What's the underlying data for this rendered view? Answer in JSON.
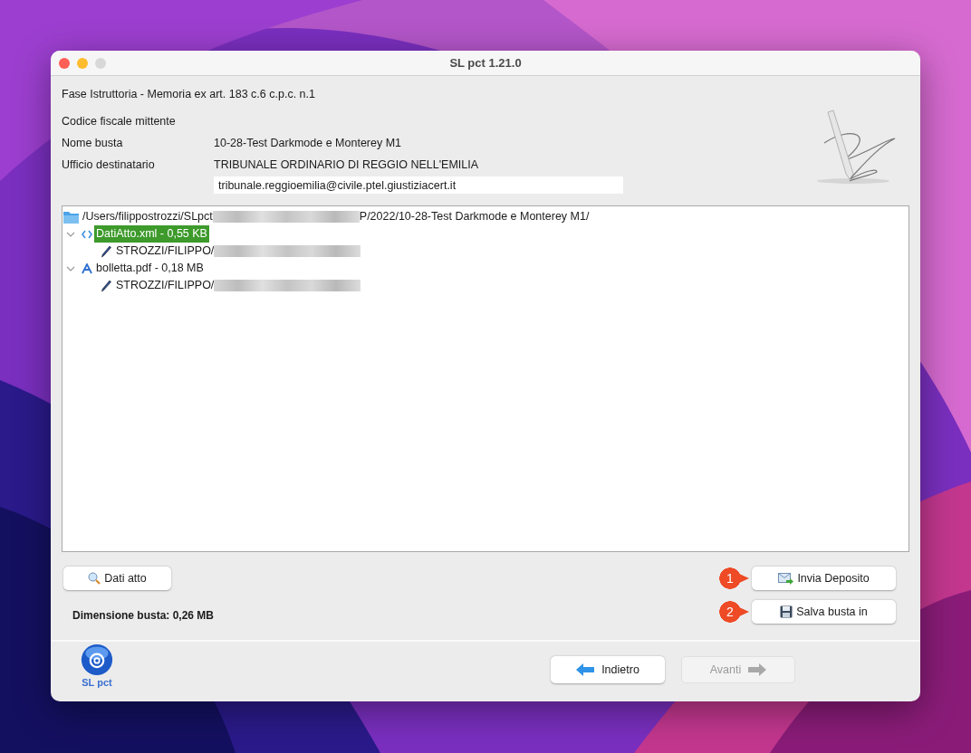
{
  "window": {
    "title": "SL pct 1.21.0"
  },
  "phase": "Fase Istruttoria - Memoria ex art. 183 c.6 c.p.c. n.1",
  "fields": [
    {
      "label": "Codice fiscale mittente"
    },
    {
      "label": "Nome busta",
      "value": "10-28-Test Darkmode e Monterey M1"
    },
    {
      "label": "Ufficio destinatario",
      "value": "TRIBUNALE ORDINARIO DI REGGIO NELL'EMILIA"
    }
  ],
  "email": {
    "value": "tribunale.reggioemilia@civile.ptel.giustiziacert.it"
  },
  "tree": {
    "path_start": "/Users/filippostrozzi/SLpct",
    "path_end": "P/2022/10-28-Test Darkmode e Monterey M1/",
    "children": [
      {
        "kind": "xml",
        "name": "DatiAtto.xml - 0,55 KB",
        "selected": true,
        "expanded": true,
        "children": [
          {
            "kind": "signature",
            "text": "STROZZI/FILIPPO/"
          }
        ]
      },
      {
        "kind": "pdf",
        "name": "bolletta.pdf - 0,18 MB",
        "selected": false,
        "expanded": true,
        "children": [
          {
            "kind": "signature",
            "text": "STROZZI/FILIPPO/"
          }
        ]
      }
    ]
  },
  "dati_button": "Dati atto",
  "size": "Dimensione busta: 0,26 MB",
  "actions": [
    {
      "kind": "send",
      "callout": "1",
      "label": "Invia Deposito"
    },
    {
      "kind": "save",
      "callout": "2",
      "label": "Salva busta in"
    }
  ],
  "nav": [
    {
      "kind": "back",
      "label": "Indietro",
      "disabled": false
    },
    {
      "kind": "next",
      "label": "Avanti",
      "disabled": true
    }
  ],
  "logo": {
    "text": "SL pct"
  }
}
